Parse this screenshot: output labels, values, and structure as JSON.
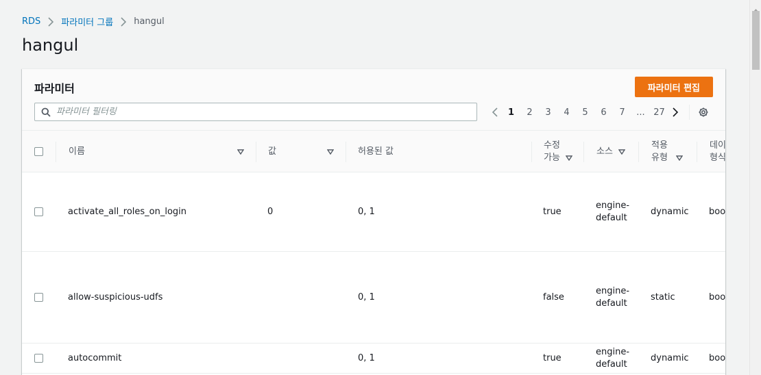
{
  "breadcrumb": {
    "items": [
      "RDS",
      "파라미터 그룹"
    ],
    "current": "hangul"
  },
  "page_title": "hangul",
  "container": {
    "title": "파라미터",
    "edit_button": "파라미터 편집",
    "search_placeholder": "파라미터 필터링"
  },
  "pagination": {
    "pages": [
      "1",
      "2",
      "3",
      "4",
      "5",
      "6",
      "7",
      "...",
      "27"
    ],
    "current": "1"
  },
  "table": {
    "columns": {
      "name": "이름",
      "value": "값",
      "allowed": "허용된 값",
      "modifiable": "수정 가능",
      "source": "소스",
      "apply_type": "적용 유형",
      "data_type": "데이터 형식"
    },
    "rows": [
      {
        "name": "activate_all_roles_on_login",
        "value": "0",
        "allowed": "0, 1",
        "modifiable": "true",
        "source": "engine-default",
        "apply_type": "dynamic",
        "data_type": "boolean"
      },
      {
        "name": "allow-suspicious-udfs",
        "value": "",
        "allowed": "0, 1",
        "modifiable": "false",
        "source": "engine-default",
        "apply_type": "static",
        "data_type": "boolean"
      },
      {
        "name": "autocommit",
        "value": "",
        "allowed": "0, 1",
        "modifiable": "true",
        "source": "engine-default",
        "apply_type": "dynamic",
        "data_type": "boolean"
      }
    ]
  },
  "colors": {
    "accent": "#ec7211",
    "link": "#0073bb",
    "background": "#f2f3f3"
  }
}
